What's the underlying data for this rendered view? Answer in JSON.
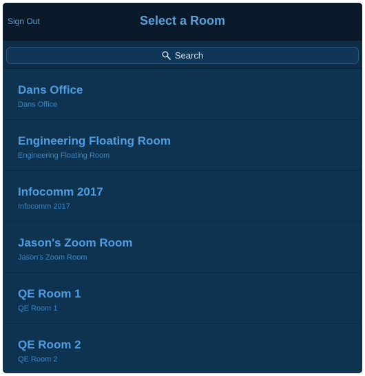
{
  "header": {
    "sign_out_label": "Sign Out",
    "title": "Select a Room"
  },
  "search": {
    "label": "Search",
    "icon": "search-icon"
  },
  "rooms": [
    {
      "name": "Dans Office",
      "subtitle": "Dans Office"
    },
    {
      "name": "Engineering Floating Room",
      "subtitle": "Engineering Floating Room"
    },
    {
      "name": "Infocomm 2017",
      "subtitle": "Infocomm 2017"
    },
    {
      "name": "Jason's Zoom Room",
      "subtitle": "Jason's Zoom Room"
    },
    {
      "name": "QE Room 1",
      "subtitle": "QE Room 1"
    },
    {
      "name": "QE Room 2",
      "subtitle": "QE Room 2"
    }
  ],
  "colors": {
    "header_bg": "#0b1a2b",
    "panel_bg": "#0e3350",
    "accent": "#4f9ce0"
  }
}
